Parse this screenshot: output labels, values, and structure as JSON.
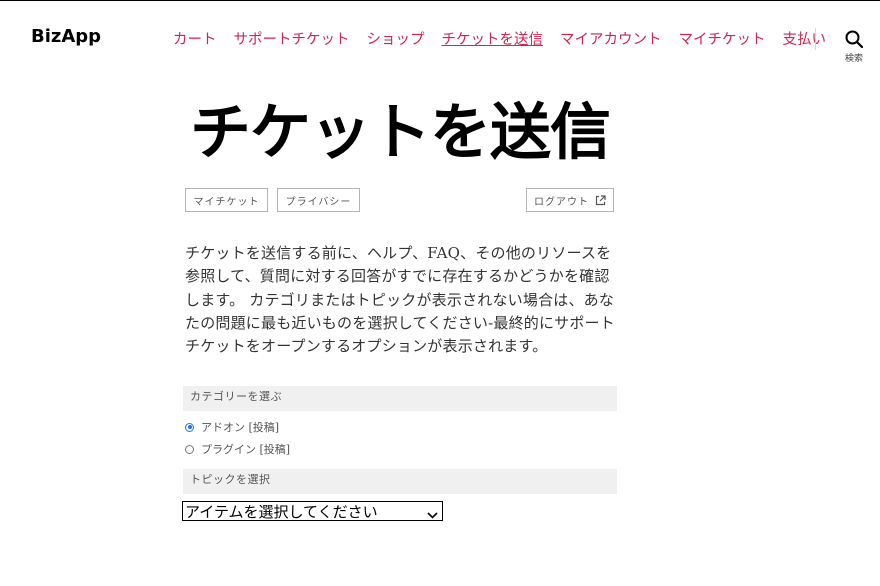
{
  "site": {
    "logo": "BizApp"
  },
  "nav": {
    "items": [
      {
        "label": "カート"
      },
      {
        "label": "サポートチケット"
      },
      {
        "label": "ショップ"
      },
      {
        "label": "チケットを送信"
      },
      {
        "label": "マイアカウント"
      },
      {
        "label": "マイチケット"
      },
      {
        "label": "支払い"
      }
    ],
    "current_index": 3,
    "link_color": "#cd2653"
  },
  "search": {
    "label": "検索",
    "icon": "search-icon"
  },
  "page": {
    "title": "チケットを送信"
  },
  "actions": {
    "my_tickets": "マイチケット",
    "privacy": "プライバシー",
    "logout": "ログアウト",
    "logout_icon": "external-link-icon"
  },
  "intro": "チケットを送信する前に、ヘルプ、FAQ、その他のリソースを参照して、質問に対する回答がすでに存在するかどうかを確認します。 カテゴリまたはトピックが表示されない場合は、あなたの問題に最も近いものを選択してください-最終的にサポートチケットをオープンするオプションが表示されます。",
  "category": {
    "heading": "カテゴリーを選ぶ",
    "options": [
      {
        "label": "アドオン [投稿]",
        "checked": true
      },
      {
        "label": "プラグイン [投稿]",
        "checked": false
      }
    ]
  },
  "topic": {
    "heading": "トピックを選択",
    "select_value": "アイテムを選択してください"
  }
}
